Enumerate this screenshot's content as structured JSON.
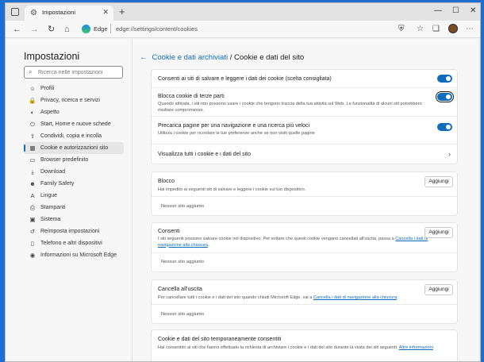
{
  "tab": {
    "title": "Impostazioni",
    "close": "✕",
    "new": "+"
  },
  "window_controls": {
    "minimize": "—",
    "maximize": "☐",
    "close": "✕"
  },
  "addressbar": {
    "back": "←",
    "forward": "→",
    "reload": "↻",
    "home": "⌂",
    "site_label": "Edge",
    "url": "edge://settings/content/cookies"
  },
  "sidebar": {
    "title": "Impostazioni",
    "search_placeholder": "Ricerca nelle impostazioni",
    "items": [
      {
        "label": "Profili",
        "icon": "☺"
      },
      {
        "label": "Privacy, ricerca e servizi",
        "icon": "🔒"
      },
      {
        "label": "Aspetto",
        "icon": "◐"
      },
      {
        "label": "Start, Home e nuove schede",
        "icon": "⏻"
      },
      {
        "label": "Condividi, copia e incolla",
        "icon": "⇪"
      },
      {
        "label": "Cookie e autorizzazioni sito",
        "icon": "▦"
      },
      {
        "label": "Browser predefinito",
        "icon": "▭"
      },
      {
        "label": "Download",
        "icon": "⤓"
      },
      {
        "label": "Family Safety",
        "icon": "☻"
      },
      {
        "label": "Lingue",
        "icon": "A"
      },
      {
        "label": "Stampanti",
        "icon": "⎙"
      },
      {
        "label": "Sistema",
        "icon": "▣"
      },
      {
        "label": "Reimposta impostazioni",
        "icon": "↺"
      },
      {
        "label": "Telefono e altri dispositivi",
        "icon": "▯"
      },
      {
        "label": "Informazioni su Microsoft Edge",
        "icon": "◉"
      }
    ]
  },
  "breadcrumb": {
    "back": "←",
    "parent": "Cookie e dati archiviati",
    "separator": " / ",
    "current": "Cookie e dati del sito"
  },
  "settings": {
    "allow_sites": {
      "label": "Consenti ai siti di salvare e leggere i dati dei cookie (scelta consigliata)"
    },
    "block_third_party": {
      "label": "Blocca cookie di terze parti",
      "desc": "Quando attivata, i siti non possono usare i cookie che tengono traccia della tua attività sul Web. Le funzionalità di alcuni siti potrebbero risultare compromesse."
    },
    "preload": {
      "label": "Precarica pagine per una navigazione e una ricerca più veloci",
      "desc": "Utilizza i cookie per ricordare le tue preferenze anche se non visiti quelle pagine"
    },
    "view_all": {
      "label": "Visualizza tutti i cookie e i dati del sito"
    }
  },
  "block": {
    "title": "Blocco",
    "desc": "Hai impedito ai seguenti siti di salvare e leggere i cookie sul tuo dispositivo.",
    "button": "Aggiungi",
    "empty": "Nessun sito aggiunto"
  },
  "allow": {
    "title": "Consenti",
    "desc_prefix": "I siti seguenti possono salvare cookie nel dispositivo. Per evitare che questi cookie vengano cancellati all'uscita, passa a ",
    "desc_link": "Cancella i dati di navigazione alla chiusura",
    "desc_suffix": ".",
    "button": "Aggiungi",
    "empty": "Nessun sito aggiunto"
  },
  "clear_exit": {
    "title": "Cancella all'uscita",
    "desc_prefix": "Per cancellare tutti i cookie e i dati del sito quando chiudi Microsoft Edge, vai a ",
    "desc_link": "Cancella i dati di navigazione alla chiusura",
    "desc_suffix": ".",
    "button": "Aggiungi",
    "empty": "Nessun sito aggiunto"
  },
  "temporary": {
    "title": "Cookie e dati del sito temporaneamente consentiti",
    "desc_prefix": "Hai consentito ai siti che hanno effettuato la richiesta di archiviare i cookie e i dati del sito durante la visita dei siti seguenti. ",
    "desc_link": "Altre informazioni"
  },
  "colors": {
    "accent": "#0f6cbd",
    "desktop": "#1c6fd1"
  }
}
